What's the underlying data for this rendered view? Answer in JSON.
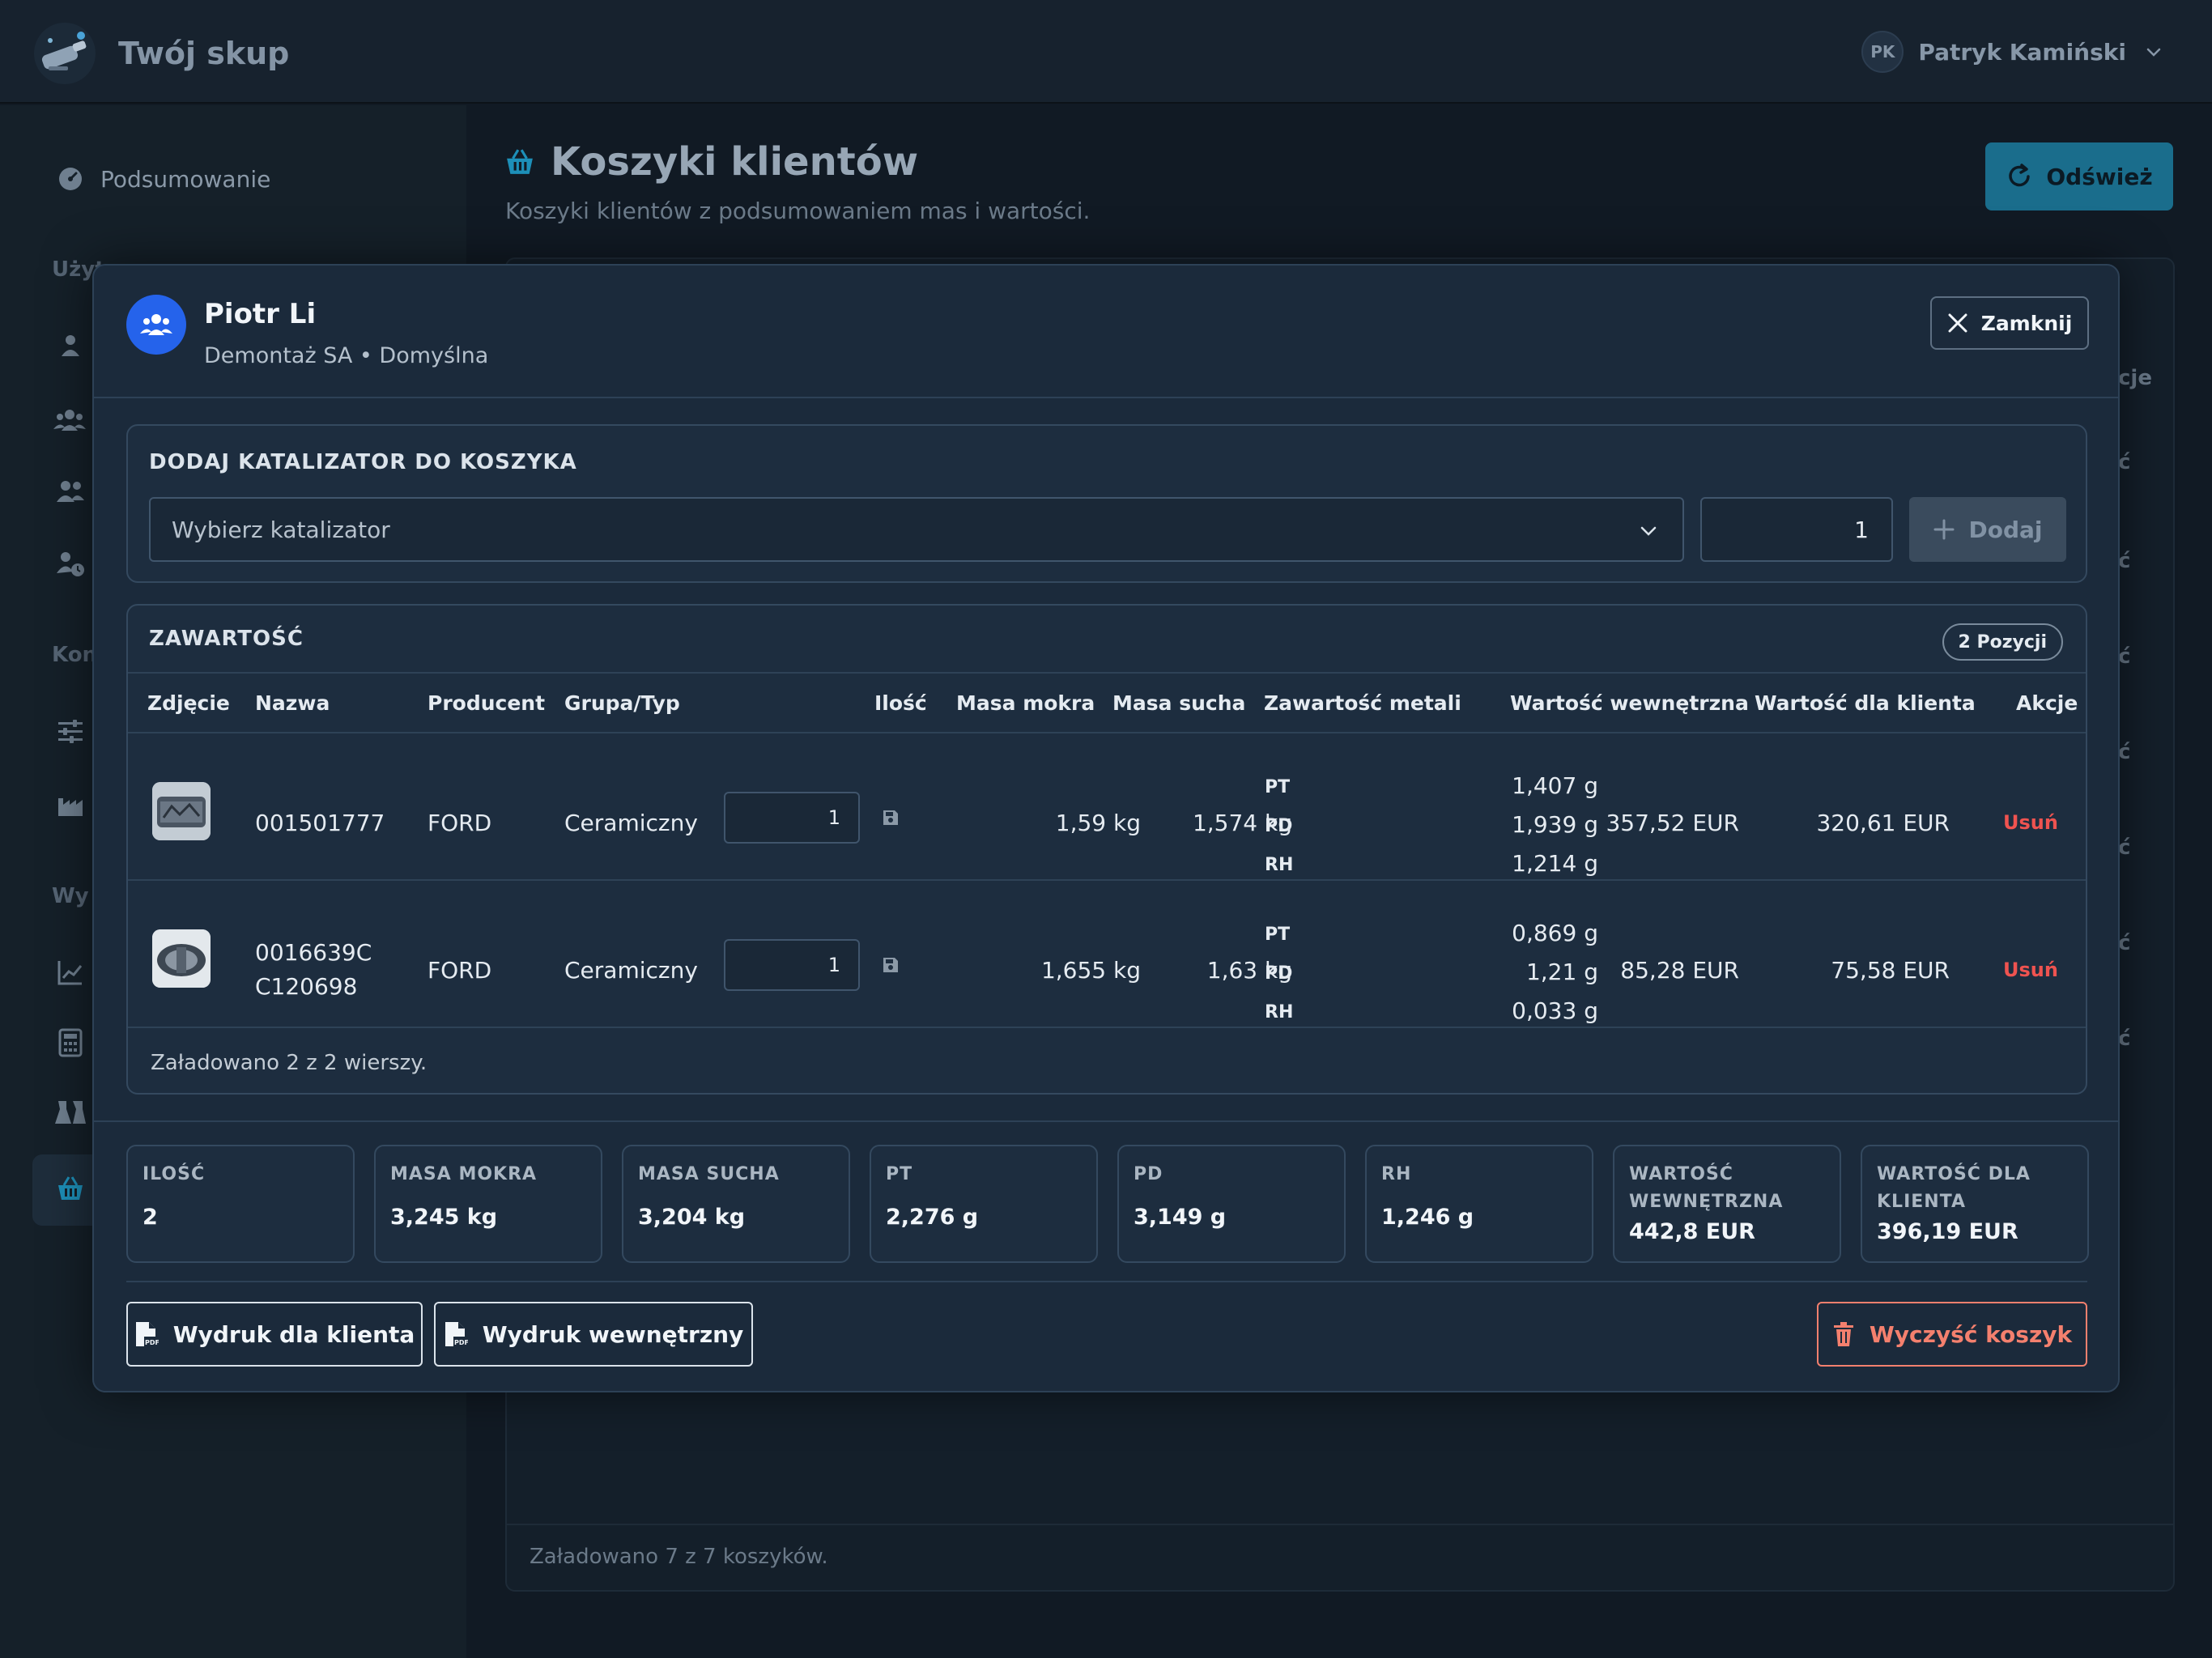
{
  "app": {
    "name": "Twój skup"
  },
  "user": {
    "initials": "PK",
    "name": "Patryk Kamiński"
  },
  "sidebar": {
    "items": [
      {
        "label": "Podsumowanie",
        "icon": "dashboard-icon"
      }
    ],
    "sections": [
      "Użytkownicy",
      "Kon",
      "Wy"
    ],
    "section_visible": [
      "Użyt",
      "Kon",
      "Wy"
    ]
  },
  "page": {
    "title": "Koszyki klientów",
    "subtitle": "Koszyki klientów z podsumowaniem mas i wartości.",
    "refresh_label": "Odśwież",
    "footer": "Załadowano 7 z 7 koszyków.",
    "actions_fragment": "cje",
    "row_fragment": "ć"
  },
  "modal": {
    "name": "Piotr Li",
    "subtitle": "Demontaż SA • Domyślna",
    "close_label": "Zamknij",
    "add_section": {
      "title": "DODAJ KATALIZATOR DO KOSZYKA",
      "select_placeholder": "Wybierz katalizator",
      "quantity": "1",
      "add_label": "Dodaj"
    },
    "content": {
      "title": "ZAWARTOŚĆ",
      "badge": "2 Pozycji",
      "columns": [
        "Zdjęcie",
        "Nazwa",
        "Producent",
        "Grupa/Typ",
        "Ilość",
        "Masa mokra",
        "Masa sucha",
        "Zawartość metali",
        "Wartość wewnętrzna",
        "Wartość dla klienta",
        "Akcje"
      ],
      "rows": [
        {
          "name_line1": "001501777",
          "name_line2": "",
          "producer": "FORD",
          "group": "Ceramiczny",
          "qty": "1",
          "wet": "1,59 kg",
          "dry": "1,574 kg",
          "metals": [
            {
              "label": "PT",
              "value": "1,407 g"
            },
            {
              "label": "PD",
              "value": "1,939 g"
            },
            {
              "label": "RH",
              "value": "1,214 g"
            }
          ],
          "internal": "357,52 EUR",
          "client": "320,61 EUR",
          "action": "Usuń"
        },
        {
          "name_line1": "0016639C",
          "name_line2": "C120698",
          "producer": "FORD",
          "group": "Ceramiczny",
          "qty": "1",
          "wet": "1,655 kg",
          "dry": "1,63 kg",
          "metals": [
            {
              "label": "PT",
              "value": "0,869 g"
            },
            {
              "label": "PD",
              "value": "1,21 g"
            },
            {
              "label": "RH",
              "value": "0,033 g"
            }
          ],
          "internal": "85,28 EUR",
          "client": "75,58 EUR",
          "action": "Usuń"
        }
      ],
      "footer": "Załadowano 2 z 2 wierszy."
    },
    "stats": [
      {
        "label": "ILOŚĆ",
        "value": "2"
      },
      {
        "label": "MASA MOKRA",
        "value": "3,245 kg"
      },
      {
        "label": "MASA SUCHA",
        "value": "3,204 kg"
      },
      {
        "label": "PT",
        "value": "2,276 g"
      },
      {
        "label": "PD",
        "value": "3,149 g"
      },
      {
        "label": "RH",
        "value": "1,246 g"
      },
      {
        "label": "WARTOŚĆ WEWNĘTRZNA",
        "value": "442,8 EUR"
      },
      {
        "label": "WARTOŚĆ DLA KLIENTA",
        "value": "396,19 EUR"
      }
    ],
    "buttons": {
      "print_client": "Wydruk dla klienta",
      "print_internal": "Wydruk wewnętrzny",
      "clear": "Wyczyść koszyk"
    }
  },
  "colors": {
    "accent": "#1a6d8c",
    "avatar_blue": "#2563eb",
    "danger": "#ef5350",
    "danger_outline": "#f4806e"
  }
}
